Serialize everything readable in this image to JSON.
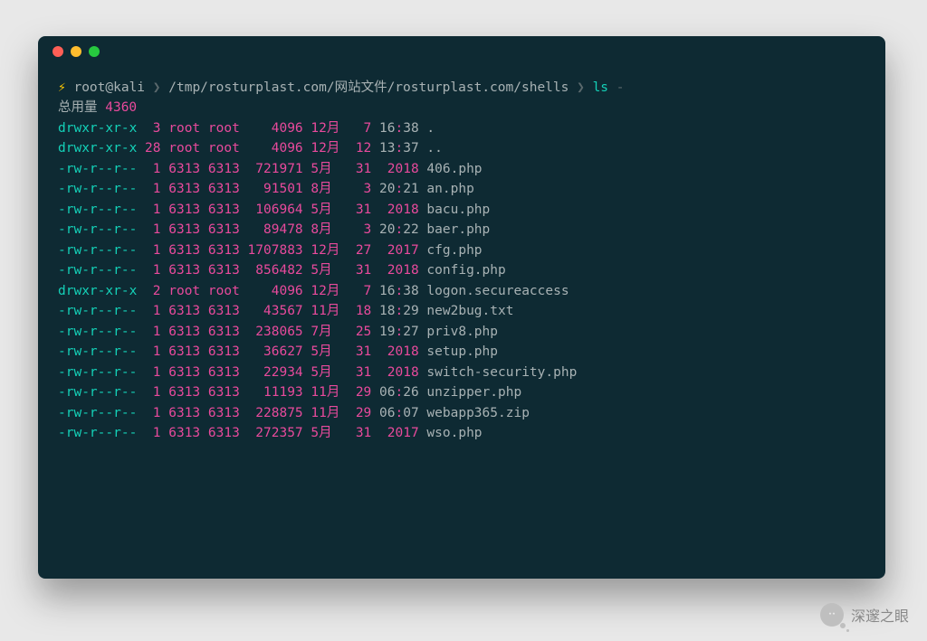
{
  "prompt": {
    "bolt": "⚡",
    "user": "root@kali",
    "arrow1": "❯",
    "path": "/tmp/rosturplast.com/网站文件/rosturplast.com/shells",
    "arrow2": "❯",
    "command": "ls",
    "flag": "-"
  },
  "summary": {
    "label": "总用量",
    "value": "4360"
  },
  "files": [
    {
      "perm": "drwxr-xr-x",
      "isdir": true,
      "links": "3",
      "owner": "root",
      "group": "root",
      "size": "4096",
      "month": "12月",
      "day": "7",
      "time": "16:38",
      "colon": true,
      "name": "."
    },
    {
      "perm": "drwxr-xr-x",
      "isdir": true,
      "links": "28",
      "owner": "root",
      "group": "root",
      "size": "4096",
      "month": "12月",
      "day": "12",
      "time": "13:37",
      "colon": true,
      "name": ".."
    },
    {
      "perm": "-rw-r--r--",
      "isdir": false,
      "links": "1",
      "owner": "6313",
      "group": "6313",
      "size": "721971",
      "month": "5月",
      "day": "31",
      "time": "2018",
      "colon": false,
      "name": "406.php"
    },
    {
      "perm": "-rw-r--r--",
      "isdir": false,
      "links": "1",
      "owner": "6313",
      "group": "6313",
      "size": "91501",
      "month": "8月",
      "day": "3",
      "time": "20:21",
      "colon": true,
      "name": "an.php"
    },
    {
      "perm": "-rw-r--r--",
      "isdir": false,
      "links": "1",
      "owner": "6313",
      "group": "6313",
      "size": "106964",
      "month": "5月",
      "day": "31",
      "time": "2018",
      "colon": false,
      "name": "bacu.php"
    },
    {
      "perm": "-rw-r--r--",
      "isdir": false,
      "links": "1",
      "owner": "6313",
      "group": "6313",
      "size": "89478",
      "month": "8月",
      "day": "3",
      "time": "20:22",
      "colon": true,
      "name": "baer.php"
    },
    {
      "perm": "-rw-r--r--",
      "isdir": false,
      "links": "1",
      "owner": "6313",
      "group": "6313",
      "size": "1707883",
      "month": "12月",
      "day": "27",
      "time": "2017",
      "colon": false,
      "name": "cfg.php"
    },
    {
      "perm": "-rw-r--r--",
      "isdir": false,
      "links": "1",
      "owner": "6313",
      "group": "6313",
      "size": "856482",
      "month": "5月",
      "day": "31",
      "time": "2018",
      "colon": false,
      "name": "config.php"
    },
    {
      "perm": "drwxr-xr-x",
      "isdir": true,
      "links": "2",
      "owner": "root",
      "group": "root",
      "size": "4096",
      "month": "12月",
      "day": "7",
      "time": "16:38",
      "colon": true,
      "name": "logon.secureaccess"
    },
    {
      "perm": "-rw-r--r--",
      "isdir": false,
      "links": "1",
      "owner": "6313",
      "group": "6313",
      "size": "43567",
      "month": "11月",
      "day": "18",
      "time": "18:29",
      "colon": true,
      "name": "new2bug.txt"
    },
    {
      "perm": "-rw-r--r--",
      "isdir": false,
      "links": "1",
      "owner": "6313",
      "group": "6313",
      "size": "238065",
      "month": "7月",
      "day": "25",
      "time": "19:27",
      "colon": true,
      "name": "priv8.php"
    },
    {
      "perm": "-rw-r--r--",
      "isdir": false,
      "links": "1",
      "owner": "6313",
      "group": "6313",
      "size": "36627",
      "month": "5月",
      "day": "31",
      "time": "2018",
      "colon": false,
      "name": "setup.php"
    },
    {
      "perm": "-rw-r--r--",
      "isdir": false,
      "links": "1",
      "owner": "6313",
      "group": "6313",
      "size": "22934",
      "month": "5月",
      "day": "31",
      "time": "2018",
      "colon": false,
      "name": "switch-security.php"
    },
    {
      "perm": "-rw-r--r--",
      "isdir": false,
      "links": "1",
      "owner": "6313",
      "group": "6313",
      "size": "11193",
      "month": "11月",
      "day": "29",
      "time": "06:26",
      "colon": true,
      "name": "unzipper.php"
    },
    {
      "perm": "-rw-r--r--",
      "isdir": false,
      "links": "1",
      "owner": "6313",
      "group": "6313",
      "size": "228875",
      "month": "11月",
      "day": "29",
      "time": "06:07",
      "colon": true,
      "name": "webapp365.zip"
    },
    {
      "perm": "-rw-r--r--",
      "isdir": false,
      "links": "1",
      "owner": "6313",
      "group": "6313",
      "size": "272357",
      "month": "5月",
      "day": "31",
      "time": "2017",
      "colon": false,
      "name": "wso.php"
    }
  ],
  "watermark": "深邃之眼"
}
